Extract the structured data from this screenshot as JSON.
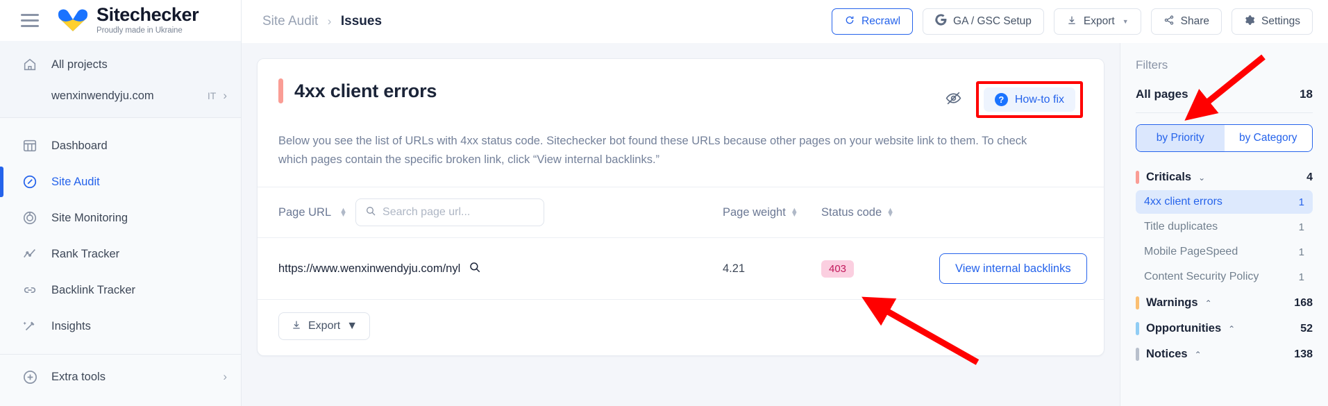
{
  "brand": {
    "name": "Sitechecker",
    "tagline": "Proudly made in Ukraine"
  },
  "sidebar": {
    "all_projects": "All projects",
    "project": {
      "name": "wenxinwendyju.com",
      "tag": "IT"
    },
    "items": [
      {
        "label": "Dashboard",
        "icon": "dashboard-icon",
        "active": false
      },
      {
        "label": "Site Audit",
        "icon": "site-audit-icon",
        "active": true
      },
      {
        "label": "Site Monitoring",
        "icon": "site-monitoring-icon",
        "active": false
      },
      {
        "label": "Rank Tracker",
        "icon": "rank-tracker-icon",
        "active": false
      },
      {
        "label": "Backlink Tracker",
        "icon": "backlink-tracker-icon",
        "active": false
      },
      {
        "label": "Insights",
        "icon": "insights-icon",
        "active": false
      }
    ],
    "extra_tools": "Extra tools"
  },
  "topbar": {
    "breadcrumb_parent": "Site Audit",
    "breadcrumb_sep": "›",
    "breadcrumb_current": "Issues",
    "recrawl": "Recrawl",
    "ga_gsc": "GA / GSC Setup",
    "export": "Export",
    "share": "Share",
    "settings": "Settings"
  },
  "issue": {
    "title": "4xx client errors",
    "accent_color": "#fa9d95",
    "how_to_fix": "How-to fix",
    "description": "Below you see the list of URLs with 4xx status code. Sitechecker bot found these URLs because other pages on your website link to them. To check which pages contain the specific broken link, click “View internal backlinks.”"
  },
  "table": {
    "columns": {
      "url": "Page URL",
      "weight": "Page weight",
      "status": "Status code"
    },
    "search_placeholder": "Search page url...",
    "search_value": "",
    "rows": [
      {
        "url": "https://www.wenxinwendyju.com/nyl",
        "weight": "4.21",
        "status": "403",
        "action": "View internal backlinks"
      }
    ],
    "export": "Export"
  },
  "filters": {
    "title": "Filters",
    "all_pages": {
      "label": "All pages",
      "count": "18"
    },
    "segments": [
      {
        "label": "by Priority",
        "selected": true
      },
      {
        "label": "by Category",
        "selected": false
      }
    ],
    "groups": [
      {
        "label": "Criticals",
        "count": "4",
        "color": "#fa9d95",
        "chevron": "⌄",
        "expanded": true,
        "items": [
          {
            "label": "4xx client errors",
            "count": "1",
            "selected": true
          },
          {
            "label": "Title duplicates",
            "count": "1",
            "selected": false
          },
          {
            "label": "Mobile PageSpeed",
            "count": "1",
            "selected": false
          },
          {
            "label": "Content Security Policy",
            "count": "1",
            "selected": false
          }
        ]
      },
      {
        "label": "Warnings",
        "count": "168",
        "color": "#fbbf72",
        "chevron": "⌃",
        "expanded": false,
        "items": []
      },
      {
        "label": "Opportunities",
        "count": "52",
        "color": "#90cdf4",
        "chevron": "⌃",
        "expanded": false,
        "items": []
      },
      {
        "label": "Notices",
        "count": "138",
        "color": "#b8c0cc",
        "chevron": "⌃",
        "expanded": false,
        "items": []
      }
    ]
  },
  "annotations": {
    "highlight_color": "#ff0000",
    "arrow_count": "2"
  }
}
